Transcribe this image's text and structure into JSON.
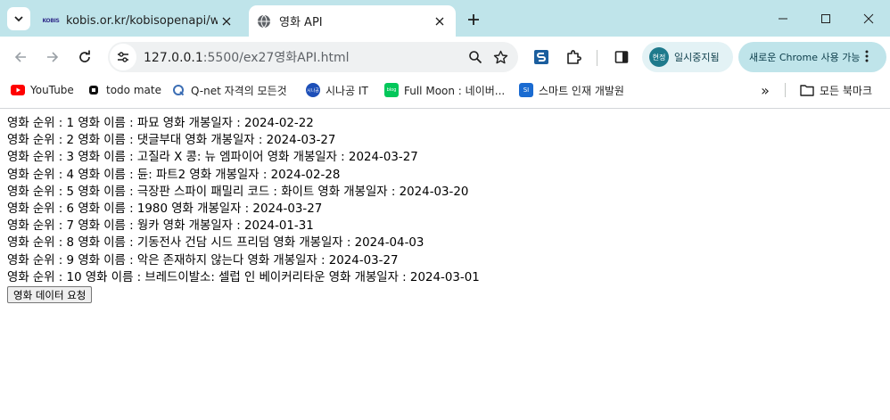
{
  "browser": {
    "tabs": [
      {
        "title": "kobis.or.kr/kobisopenapi/webse",
        "favicon_text": "KOBIS",
        "active": false
      },
      {
        "title": "영화 API",
        "favicon": "globe-icon",
        "active": true
      }
    ],
    "address": {
      "host": "127.0.0.1",
      "path": ":5500/ex27영화API.html"
    },
    "profile": {
      "avatar_text": "현정",
      "status": "일시중지됨"
    },
    "update_label": "새로운 Chrome 사용 가능",
    "bookmarks": [
      {
        "label": "YouTube",
        "icon": "youtube-icon"
      },
      {
        "label": "todo mate",
        "icon": "todo-mate-icon"
      },
      {
        "label": "Q-net 자격의 모든것",
        "icon": "qnet-icon"
      },
      {
        "label": "시나공 IT",
        "icon": "sinagong-icon",
        "icon_text": "시나공"
      },
      {
        "label": "Full Moon : 네이버...",
        "icon": "blog-icon",
        "icon_text": "blog"
      },
      {
        "label": "스마트 인재 개발원",
        "icon": "smart-icon",
        "icon_text": "SI"
      }
    ],
    "bookmarks_more": "»",
    "all_bookmarks": "모든 북마크"
  },
  "page": {
    "movies": [
      "영화 순위 : 1 영화 이름 : 파묘 영화 개봉일자 : 2024-02-22",
      "영화 순위 : 2 영화 이름 : 댓글부대 영화 개봉일자 : 2024-03-27",
      "영화 순위 : 3 영화 이름 : 고질라 X 콩: 뉴 엠파이어 영화 개봉일자 : 2024-03-27",
      "영화 순위 : 4 영화 이름 : 듄: 파트2 영화 개봉일자 : 2024-02-28",
      "영화 순위 : 5 영화 이름 : 극장판 스파이 패밀리 코드 : 화이트 영화 개봉일자 : 2024-03-20",
      "영화 순위 : 6 영화 이름 : 1980 영화 개봉일자 : 2024-03-27",
      "영화 순위 : 7 영화 이름 : 웡카 영화 개봉일자 : 2024-01-31",
      "영화 순위 : 8 영화 이름 : 기동전사 건담 시드 프리덤 영화 개봉일자 : 2024-04-03",
      "영화 순위 : 9 영화 이름 : 악은 존재하지 않는다 영화 개봉일자 : 2024-03-27",
      "영화 순위 : 10 영화 이름 : 브레드이발소: 셀럽 인 베이커리타운 영화 개봉일자 : 2024-03-01"
    ],
    "request_button": "영화 데이터 요청"
  }
}
